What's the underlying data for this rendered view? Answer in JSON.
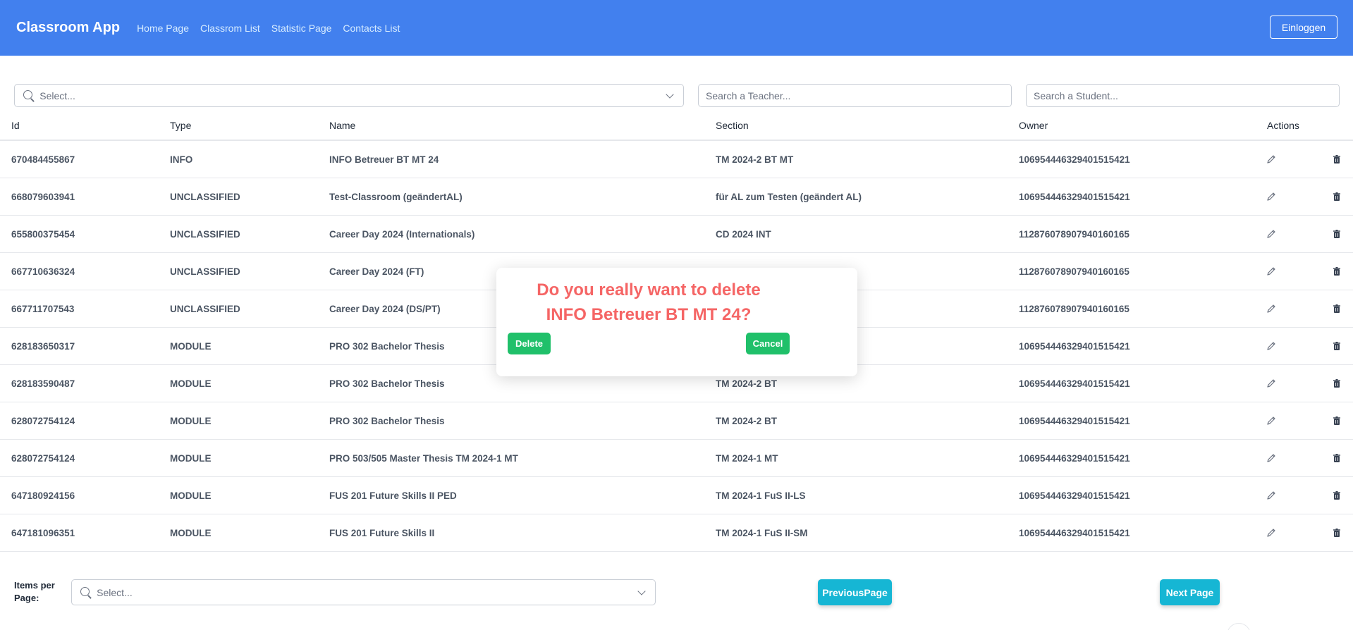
{
  "header": {
    "brand": "Classroom App",
    "nav": [
      "Home Page",
      "Classrom List",
      "Statistic Page",
      "Contacts List"
    ],
    "login_label": "Einloggen"
  },
  "filters": {
    "select_placeholder": "Select...",
    "teacher_placeholder": "Search a Teacher...",
    "student_placeholder": "Search a Student..."
  },
  "table": {
    "headers": [
      "Id",
      "Type",
      "Name",
      "Section",
      "Owner",
      "Actions"
    ],
    "rows": [
      {
        "id": "670484455867",
        "type": "INFO",
        "name": "INFO Betreuer BT MT 24",
        "section": "TM 2024-2 BT MT",
        "owner": "106954446329401515421"
      },
      {
        "id": "668079603941",
        "type": "UNCLASSIFIED",
        "name": "Test-Classroom (geändertAL)",
        "section": "für AL zum Testen (geändert AL)",
        "owner": "106954446329401515421"
      },
      {
        "id": "655800375454",
        "type": "UNCLASSIFIED",
        "name": "Career Day 2024 (Internationals)",
        "section": "CD 2024 INT",
        "owner": "112876078907940160165"
      },
      {
        "id": "667710636324",
        "type": "UNCLASSIFIED",
        "name": "Career Day 2024 (FT)",
        "section": "",
        "owner": "112876078907940160165"
      },
      {
        "id": "667711707543",
        "type": "UNCLASSIFIED",
        "name": "Career Day 2024 (DS/PT)",
        "section": "",
        "owner": "112876078907940160165"
      },
      {
        "id": "628183650317",
        "type": "MODULE",
        "name": "PRO 302 Bachelor Thesis",
        "section": "",
        "owner": "106954446329401515421"
      },
      {
        "id": "628183590487",
        "type": "MODULE",
        "name": "PRO 302 Bachelor Thesis",
        "section": "TM 2024-2 BT",
        "owner": "106954446329401515421"
      },
      {
        "id": "628072754124",
        "type": "MODULE",
        "name": "PRO 302 Bachelor Thesis",
        "section": "TM 2024-2 BT",
        "owner": "106954446329401515421"
      },
      {
        "id": "628072754124",
        "type": "MODULE",
        "name": "PRO 503/505 Master Thesis TM 2024-1 MT",
        "section": "TM 2024-1 MT",
        "owner": "106954446329401515421"
      },
      {
        "id": "647180924156",
        "type": "MODULE",
        "name": "FUS 201 Future Skills II PED",
        "section": "TM 2024-1 FuS II-LS",
        "owner": "106954446329401515421"
      },
      {
        "id": "647181096351",
        "type": "MODULE",
        "name": "FUS 201 Future Skills II",
        "section": "TM 2024-1 FuS II-SM",
        "owner": "106954446329401515421"
      }
    ]
  },
  "pagination": {
    "items_per_page_label": "Items per Page:",
    "items_per_page_placeholder": "Select...",
    "previous_label": "PreviousPage",
    "next_label": "Next Page"
  },
  "modal": {
    "title_line1": "Do you really want to delete",
    "title_line2": "INFO Betreuer BT MT 24?",
    "delete_label": "Delete",
    "cancel_label": "Cancel"
  },
  "colors": {
    "header_bg": "#4280ee",
    "page_button": "#16b6d4",
    "modal_button": "#20c06a",
    "modal_title": "#f56565"
  }
}
